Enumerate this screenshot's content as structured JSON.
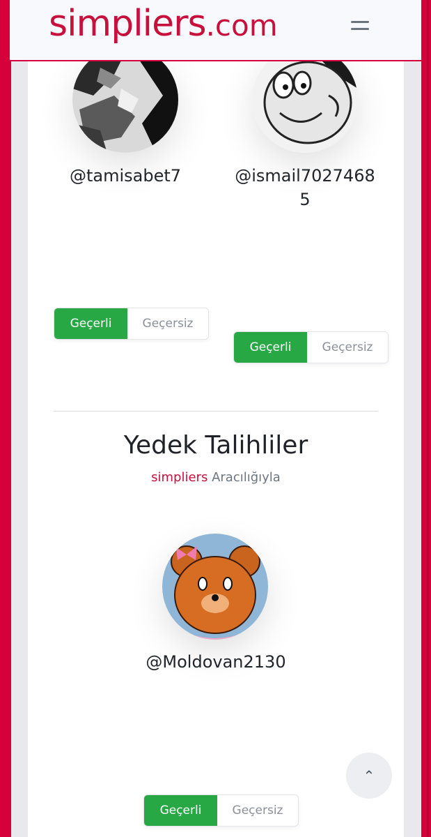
{
  "header": {
    "logo_brand": "simpliers",
    "logo_tld": ".com",
    "menu_icon": "hamburger-icon"
  },
  "winners": [
    {
      "username": "@tamisabet7",
      "valid_label": "Geçerli",
      "invalid_label": "Geçersiz"
    },
    {
      "username": "@ismail70274685",
      "valid_label": "Geçerli",
      "invalid_label": "Geçersiz"
    }
  ],
  "backup_section": {
    "title": "Yedek Talihliler",
    "by_brand": "simpliers",
    "by_text": "Aracılığıyla",
    "winners": [
      {
        "username": "@Moldovan2130",
        "valid_label": "Geçerli",
        "invalid_label": "Geçersiz"
      }
    ]
  },
  "scroll_top_icon": "chevron-up-icon",
  "colors": {
    "brand": "#c8103c",
    "frame": "#d6003a",
    "valid": "#28a745",
    "invalid_text": "#8a9099"
  }
}
